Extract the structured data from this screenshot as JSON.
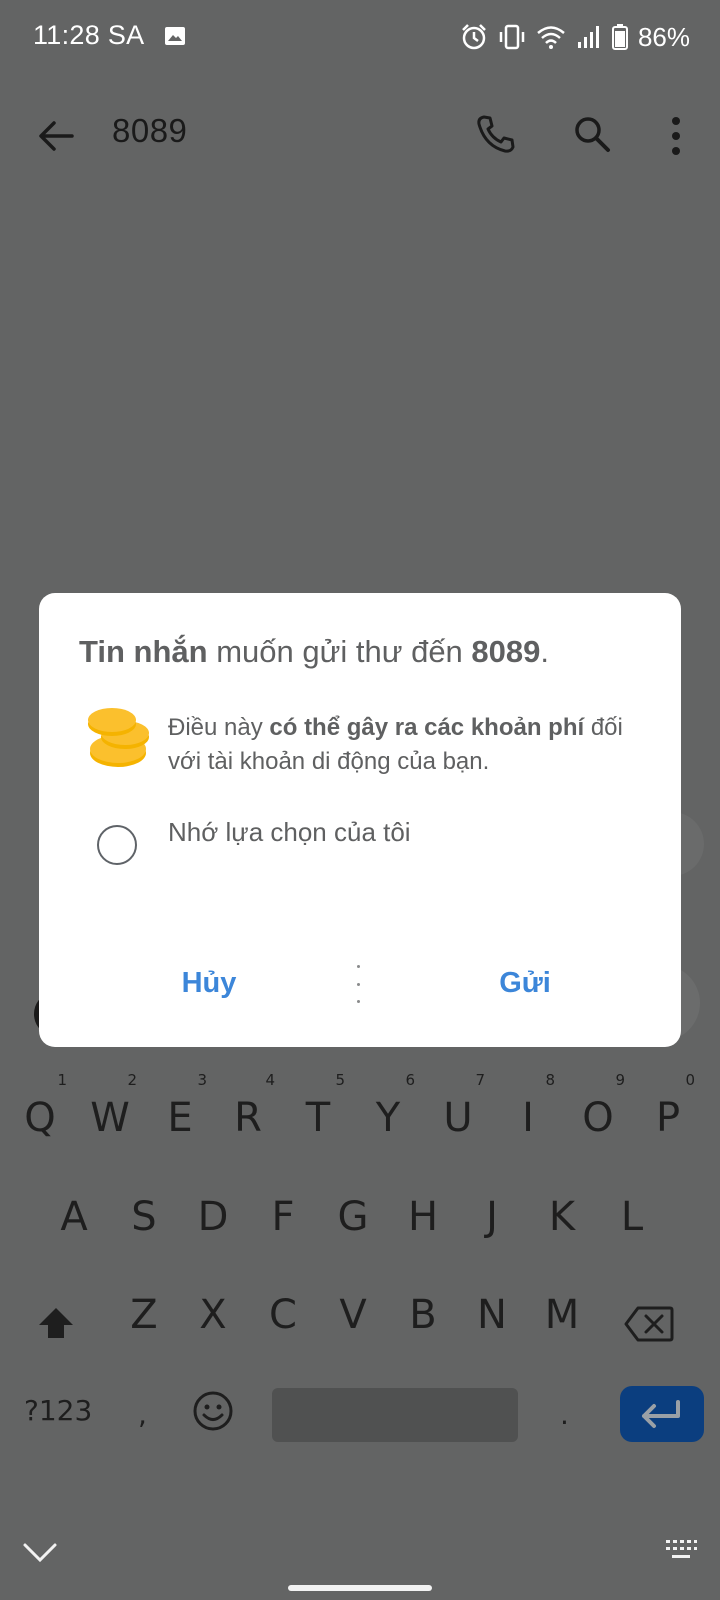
{
  "status_bar": {
    "time": "11:28 SA",
    "battery_pct": "86%",
    "icons": [
      "image-icon",
      "alarm-icon",
      "vibrate-icon",
      "wifi-icon",
      "signal-icon",
      "battery-icon"
    ]
  },
  "app_bar": {
    "title": "8089",
    "icons": [
      "back-arrow-icon",
      "phone-icon",
      "search-icon",
      "more-vert-icon"
    ]
  },
  "dialog": {
    "title_app": "Tin nhắn",
    "title_mid": " muốn gửi thư đến ",
    "title_number": "8089",
    "title_end": ".",
    "warn_pre": "Điều này ",
    "warn_bold": "có thể gây ra các khoản phí",
    "warn_post": " đối với tài khoản di động của bạn.",
    "remember_label": "Nhớ lựa chọn của tôi",
    "cancel_label": "Hủy",
    "send_label": "Gửi",
    "accent_color": "#3c86d9",
    "coin_color": "#fbc02d"
  },
  "keyboard": {
    "row1": [
      {
        "k": "Q",
        "h": "1"
      },
      {
        "k": "W",
        "h": "2"
      },
      {
        "k": "E",
        "h": "3"
      },
      {
        "k": "R",
        "h": "4"
      },
      {
        "k": "T",
        "h": "5"
      },
      {
        "k": "Y",
        "h": "6"
      },
      {
        "k": "U",
        "h": "7"
      },
      {
        "k": "I",
        "h": "8"
      },
      {
        "k": "O",
        "h": "9"
      },
      {
        "k": "P",
        "h": "0"
      }
    ],
    "row2": [
      "A",
      "S",
      "D",
      "F",
      "G",
      "H",
      "J",
      "K",
      "L"
    ],
    "row3": [
      "Z",
      "X",
      "C",
      "V",
      "B",
      "N",
      "M"
    ],
    "sym_label": "?123",
    "comma": ",",
    "period": ".",
    "enter_color": "#0b3e7f"
  }
}
